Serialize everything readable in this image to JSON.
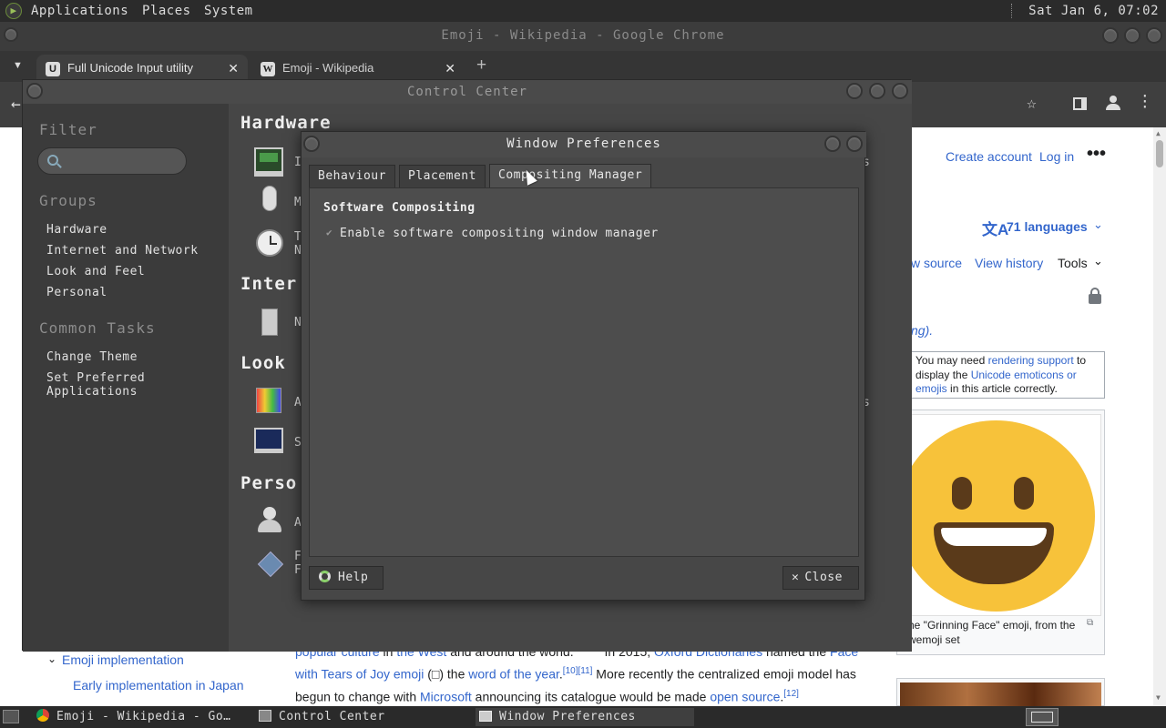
{
  "top_panel": {
    "menus": [
      "Applications",
      "Places",
      "System"
    ],
    "clock": "Sat Jan  6, 07:02"
  },
  "chrome": {
    "window_title": "Emoji - Wikipedia - Google Chrome",
    "tabs": [
      {
        "title": "Full Unicode Input utility",
        "favicon": "U"
      },
      {
        "title": "Emoji - Wikipedia",
        "favicon": "W"
      }
    ]
  },
  "wiki": {
    "create_account": "Create account",
    "log_in": "Log in",
    "languages": "71 languages",
    "view_source": "w source",
    "view_history": "View history",
    "tools": "Tools",
    "snippet_ng": "ng).",
    "notice": {
      "t1": "You may need ",
      "l1": "rendering support",
      "t2": " to display the ",
      "l2": "Unicode emoticons or emojis",
      "t3": " in this article correctly."
    },
    "caption": "he \"Grinning Face\" emoji, from the wemoji set",
    "toc": {
      "item1": "Emoji implementation",
      "item2": "Early implementation in Japan"
    },
    "body": {
      "l1a": "popular culture",
      "l1b": " in ",
      "l1c": "the West",
      "l1d": " and around the world.",
      "l1e": "In 2015, ",
      "l1f": "Oxford Dictionaries",
      "l1g": " named the ",
      "l1h": "Face",
      "l2a": "with Tears of Joy emoji",
      "l2b": " (□) the ",
      "l2c": "word of the year",
      "l2d": ".",
      "l2sup": "[10][11]",
      "l2e": " More recently the centralized emoji model has",
      "l3a": "begun to change with ",
      "l3b": "Microsoft",
      "l3c": " announcing its catalogue would be made ",
      "l3d": "open source",
      "l3e": ".",
      "l3sup": "[12]"
    }
  },
  "control_center": {
    "title": "Control Center",
    "filter_label": "Filter",
    "groups_label": "Groups",
    "groups": [
      "Hardware",
      "Internet and Network",
      "Look and Feel",
      "Personal"
    ],
    "common_tasks_label": "Common Tasks",
    "tasks": [
      "Change Theme",
      "Set Preferred",
      "Applications"
    ],
    "sections": [
      "Hardware",
      "Inter",
      "Look",
      "Perso"
    ],
    "peek": [
      "I",
      "M",
      "T",
      "N",
      "N",
      "A",
      "S",
      "A",
      "F",
      "F"
    ],
    "peek_right": [
      "s",
      "s"
    ]
  },
  "window_prefs": {
    "title": "Window Preferences",
    "tabs": [
      "Behaviour",
      "Placement",
      "Compositing Manager"
    ],
    "section_title": "Software Compositing",
    "checkbox_label": "Enable software compositing window manager",
    "checkbox_checked": true,
    "help": "Help",
    "close": "Close"
  },
  "taskbar": {
    "items": [
      "Emoji - Wikipedia - Go…",
      "Control Center",
      "Window Preferences"
    ]
  },
  "colors": {
    "link": "#3366cc",
    "dark_bg": "#444444",
    "emoji_yellow": "#f7c23a",
    "emoji_mouth": "#5a3a1a"
  }
}
